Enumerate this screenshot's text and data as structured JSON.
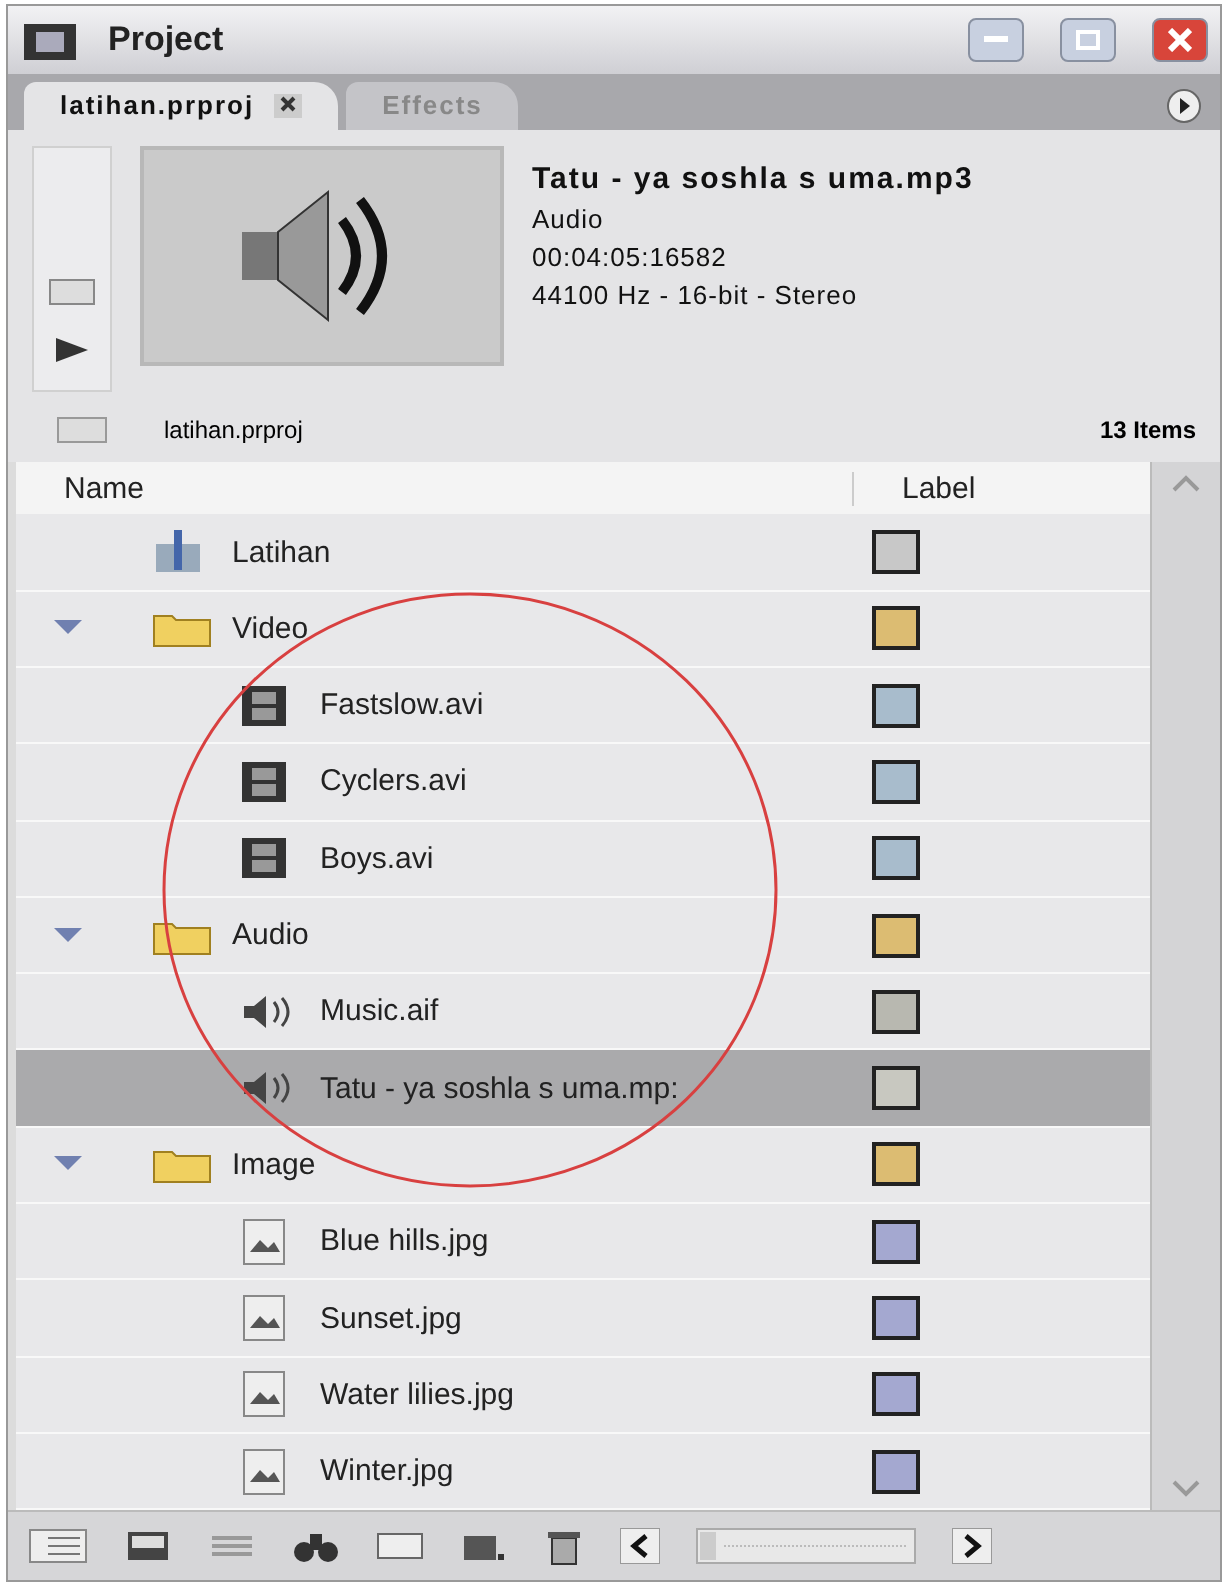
{
  "window": {
    "title": "Project"
  },
  "tabs": [
    {
      "label": "latihan.prproj",
      "selected": true,
      "closable": true
    },
    {
      "label": "Effects",
      "selected": false,
      "closable": false
    }
  ],
  "preview": {
    "name": "Tatu - ya soshla s uma.mp3",
    "type": "Audio",
    "duration": "00:04:05:16582",
    "format": "44100 Hz - 16-bit - Stereo"
  },
  "project_bar": {
    "name": "latihan.prproj",
    "count": "13 Items"
  },
  "columns": [
    "Name",
    "Label"
  ],
  "items": [
    {
      "name": "Latihan",
      "kind": "sequence",
      "color": "#c8c8c8",
      "selected": false
    },
    {
      "name": "Video",
      "kind": "folder",
      "expanded": true,
      "color": "#dcbc72",
      "selected": false,
      "children": [
        {
          "name": "Fastslow.avi",
          "kind": "video",
          "color": "#a8bccc",
          "selected": false
        },
        {
          "name": "Cyclers.avi",
          "kind": "video",
          "color": "#a8bccc",
          "selected": false
        },
        {
          "name": "Boys.avi",
          "kind": "video",
          "color": "#a8bccc",
          "selected": false
        }
      ]
    },
    {
      "name": "Audio",
      "kind": "folder",
      "expanded": true,
      "color": "#dcbc72",
      "selected": false,
      "children": [
        {
          "name": "Music.aif",
          "kind": "audio",
          "color": "#b8b8b0",
          "selected": false
        },
        {
          "name": "Tatu - ya soshla s uma.mp:",
          "kind": "audio",
          "color": "#c8c8c0",
          "selected": true
        }
      ]
    },
    {
      "name": "Image",
      "kind": "folder",
      "expanded": true,
      "color": "#dcbc72",
      "selected": false,
      "children": [
        {
          "name": "Blue hills.jpg",
          "kind": "image",
          "color": "#a4a8d0",
          "selected": false
        },
        {
          "name": "Sunset.jpg",
          "kind": "image",
          "color": "#a4a8d0",
          "selected": false
        },
        {
          "name": "Water lilies.jpg",
          "kind": "image",
          "color": "#a4a8d0",
          "selected": false
        },
        {
          "name": "Winter.jpg",
          "kind": "image",
          "color": "#a4a8d0",
          "selected": false
        }
      ]
    }
  ]
}
